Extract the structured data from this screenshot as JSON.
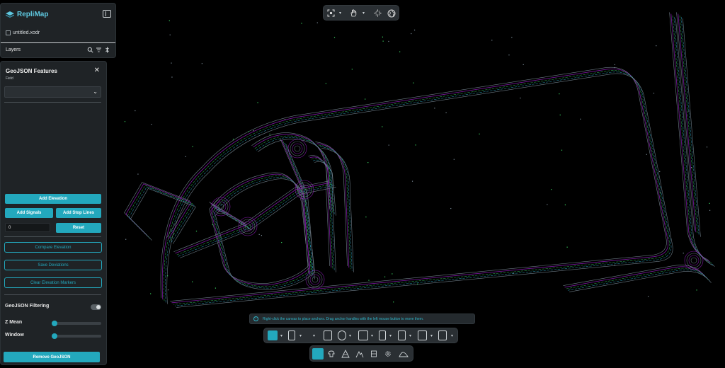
{
  "app": {
    "name": "RepliMap",
    "file_name": "untitled.xodr",
    "layers_label": "Layers"
  },
  "geojson_panel": {
    "title": "GeoJSON Features",
    "field_label": "Field",
    "field_value": "",
    "add_elevation": "Add Elevation",
    "add_signals": "Add Signals",
    "add_stop_lines": "Add Stop Lines",
    "offset_value": "0",
    "reset": "Reset",
    "compare_elevation": "Compare Elevation",
    "save_deviations": "Save Deviations",
    "clear_elevation_markers": "Clear Elevation Markers",
    "filtering_label": "GeoJSON Filtering",
    "filtering_enabled": false,
    "z_mean_label": "Z Mean",
    "z_mean_value": 0,
    "window_label": "Window",
    "window_value": 0,
    "remove_geojson": "Remove GeoJSON"
  },
  "info_banner": {
    "text": "Right-click the canvas to place anchors. Drag anchor handles with the left mouse button to move them."
  },
  "icons": {
    "top_toolbar": [
      "focus-icon",
      "pan-hand-icon",
      "fit-extent-icon",
      "globe-icon"
    ],
    "bottom_toolbar": [
      "road-tool-icon",
      "lane-tool-icon",
      "road-split-icon",
      "lane-edit-icon",
      "lane-width-icon",
      "junction-icon",
      "connection-icon",
      "lane-offset-icon",
      "road-mark-icon"
    ],
    "mode_bar": [
      "road-mode-icon",
      "object-mode-icon",
      "triangle-mode-icon",
      "elevation-mode-icon",
      "signal-mode-icon",
      "settings-mode-icon",
      "terrain-mode-icon"
    ]
  },
  "colors": {
    "accent": "#23a8bd",
    "panel_bg": "#1f2326",
    "canvas_bg": "#000000",
    "road_main": "#7a8a96",
    "road_purple": "#a020d0",
    "road_green": "#3ad060",
    "road_cyan": "#30b0d0"
  }
}
